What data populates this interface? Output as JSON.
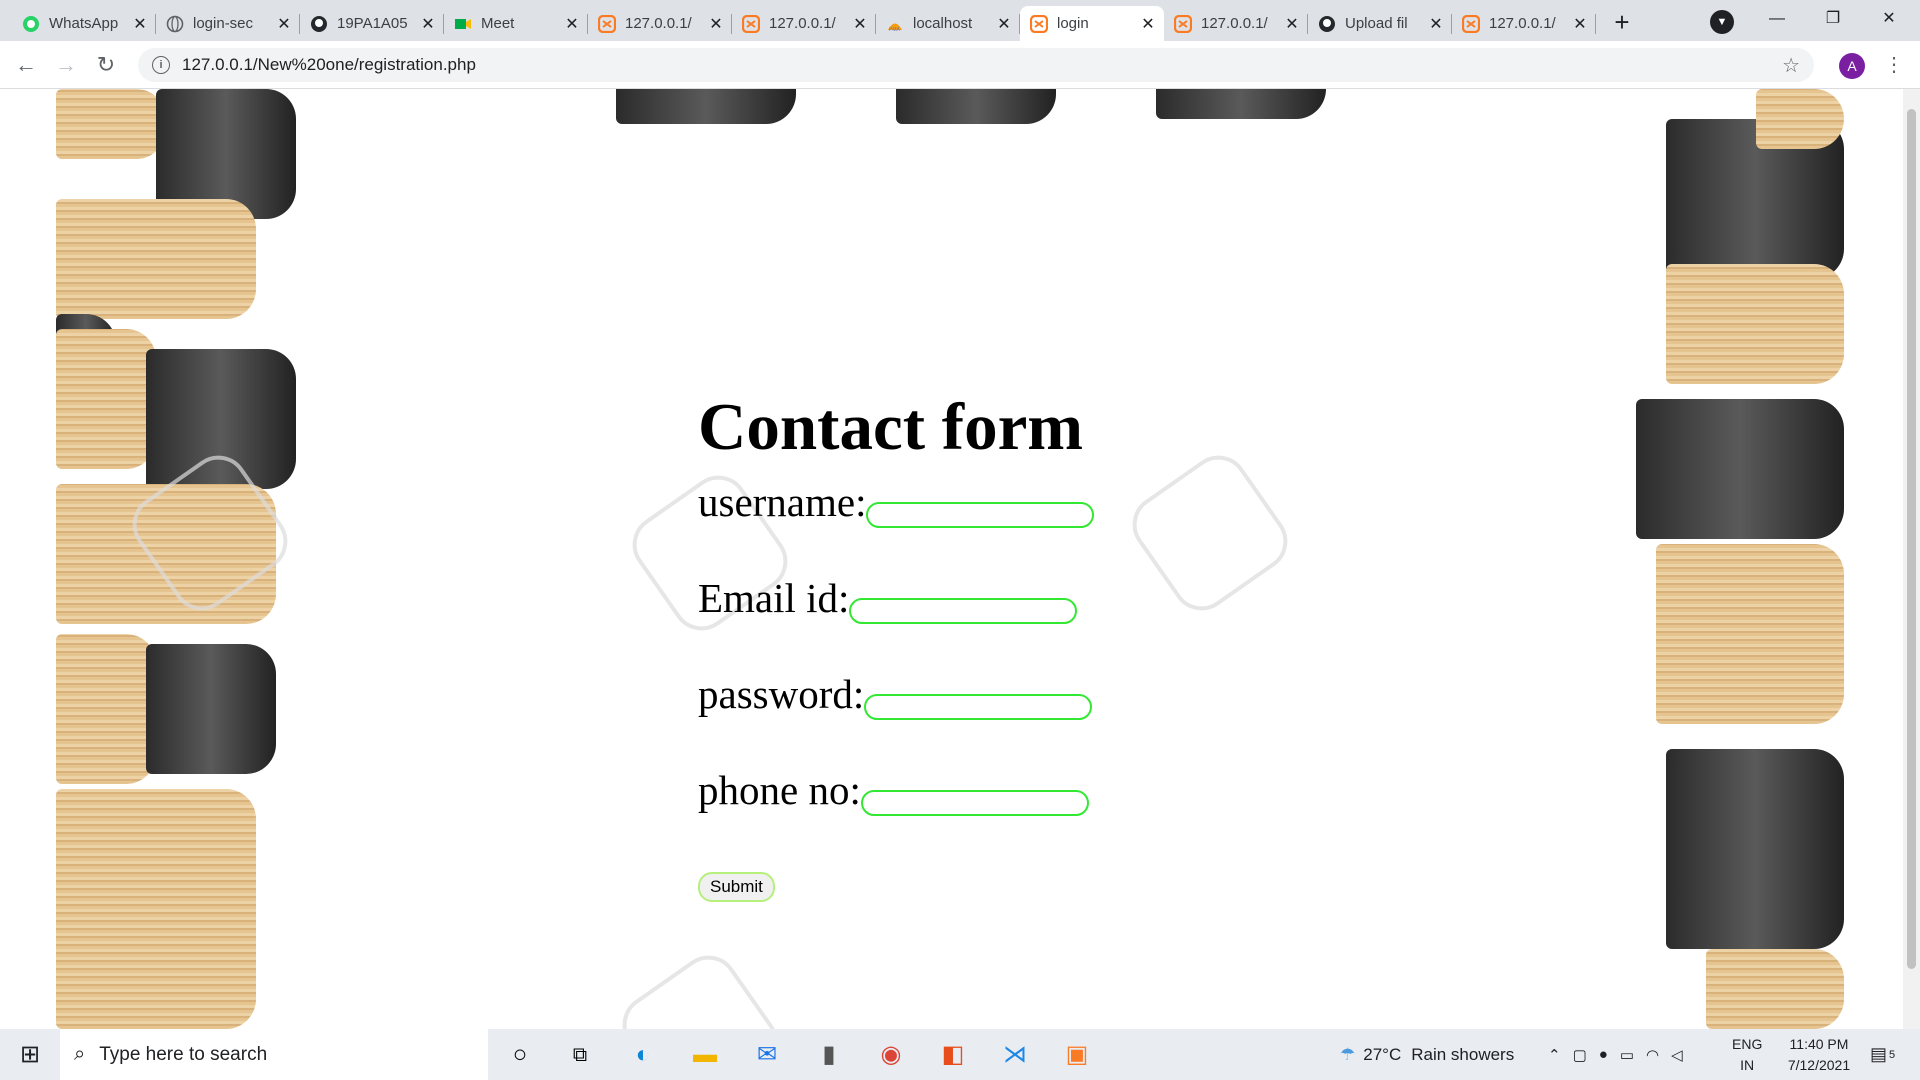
{
  "tabs": [
    {
      "title": "WhatsApp",
      "icon": "whatsapp-icon",
      "active": false
    },
    {
      "title": "login-sec",
      "icon": "globe-icon",
      "active": false
    },
    {
      "title": "19PA1A05",
      "icon": "github-icon",
      "active": false
    },
    {
      "title": "Meet",
      "icon": "meet-icon",
      "active": false
    },
    {
      "title": "127.0.0.1/",
      "icon": "xampp-icon",
      "active": false
    },
    {
      "title": "127.0.0.1/",
      "icon": "xampp-icon",
      "active": false
    },
    {
      "title": "localhost",
      "icon": "phpmyadmin-icon",
      "active": false
    },
    {
      "title": "login",
      "icon": "xampp-icon",
      "active": true
    },
    {
      "title": "127.0.0.1/",
      "icon": "xampp-icon",
      "active": false
    },
    {
      "title": "Upload fil",
      "icon": "github-icon",
      "active": false
    },
    {
      "title": "127.0.0.1/",
      "icon": "xampp-icon",
      "active": false
    }
  ],
  "browser": {
    "url": "127.0.0.1/New%20one/registration.php",
    "profile_initial": "A",
    "new_tab_symbol": "+",
    "back_symbol": "←",
    "forward_symbol": "→",
    "reload_symbol": "↻",
    "star_symbol": "☆",
    "menu_symbol": "⋮",
    "info_symbol": "i",
    "minimize_symbol": "—",
    "restore_symbol": "❐",
    "close_symbol": "✕",
    "tab_close_symbol": "✕"
  },
  "form": {
    "heading": "Contact form",
    "fields": [
      {
        "label": "username:",
        "value": ""
      },
      {
        "label": "Email id:",
        "value": ""
      },
      {
        "label": "password:",
        "value": ""
      },
      {
        "label": "phone no:",
        "value": ""
      }
    ],
    "submit_label": "Submit",
    "input_border_color": "#33e833",
    "submit_border_color": "#b6f07c"
  },
  "taskbar": {
    "search_placeholder": "Type here to search",
    "weather_temp": "27°C",
    "weather_text": "Rain showers",
    "language_top": "ENG",
    "language_bottom": "IN",
    "time": "11:40 PM",
    "date": "7/12/2021",
    "notification_count": "5"
  }
}
